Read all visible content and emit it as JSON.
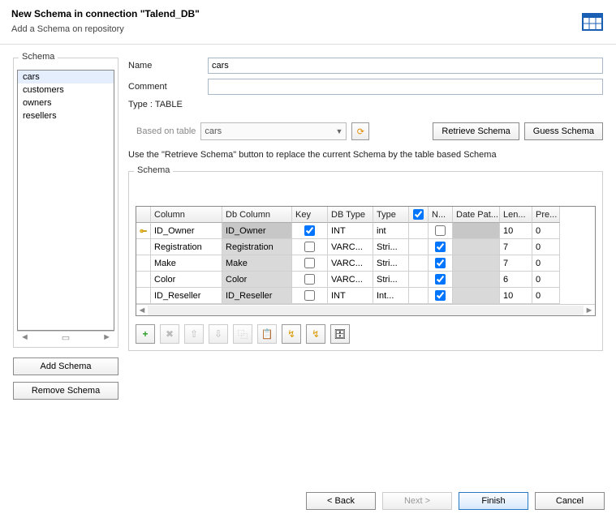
{
  "header": {
    "title": "New Schema in connection \"Talend_DB\"",
    "subtitle": "Add a Schema on repository"
  },
  "left": {
    "legend": "Schema",
    "items": [
      "cars",
      "customers",
      "owners",
      "resellers"
    ],
    "selected_index": 0,
    "add_label": "Add Schema",
    "remove_label": "Remove Schema"
  },
  "form": {
    "name_label": "Name",
    "name_value": "cars",
    "comment_label": "Comment",
    "comment_value": "",
    "type_label": "Type : TABLE",
    "based_label": "Based on table",
    "based_value": "cars",
    "retrieve_label": "Retrieve Schema",
    "guess_label": "Guess Schema",
    "hint": "Use the \"Retrieve Schema\" button to replace the current Schema by the table based Schema"
  },
  "schema": {
    "legend": "Schema",
    "headers": {
      "col": "Column",
      "dbcol": "Db Column",
      "key": "Key",
      "dbtype": "DB Type",
      "type": "Type",
      "nul_check": true,
      "nul": "N...",
      "datepat": "Date Pat...",
      "len": "Len...",
      "pre": "Pre..."
    },
    "rows": [
      {
        "iskey": true,
        "col": "ID_Owner",
        "dbcol": "ID_Owner",
        "key": true,
        "dbtype": "INT",
        "type": "int",
        "nul": false,
        "datepat": "",
        "len": "10",
        "pre": "0"
      },
      {
        "iskey": false,
        "col": "Registration",
        "dbcol": "Registration",
        "key": false,
        "dbtype": "VARC...",
        "type": "Stri...",
        "nul": true,
        "datepat": "",
        "len": "7",
        "pre": "0"
      },
      {
        "iskey": false,
        "col": "Make",
        "dbcol": "Make",
        "key": false,
        "dbtype": "VARC...",
        "type": "Stri...",
        "nul": true,
        "datepat": "",
        "len": "7",
        "pre": "0"
      },
      {
        "iskey": false,
        "col": "Color",
        "dbcol": "Color",
        "key": false,
        "dbtype": "VARC...",
        "type": "Stri...",
        "nul": true,
        "datepat": "",
        "len": "6",
        "pre": "0"
      },
      {
        "iskey": false,
        "col": "ID_Reseller",
        "dbcol": "ID_Reseller",
        "key": false,
        "dbtype": "INT",
        "type": "Int...",
        "nul": true,
        "datepat": "",
        "len": "10",
        "pre": "0"
      }
    ]
  },
  "toolbar": {
    "add": "+",
    "del": "✖",
    "up": "⇧",
    "down": "⇩",
    "copy": "⿻",
    "paste": "📋",
    "import": "↯",
    "export": "↯",
    "dbicon": "🗄"
  },
  "footer": {
    "back": "< Back",
    "next": "Next >",
    "finish": "Finish",
    "cancel": "Cancel"
  }
}
